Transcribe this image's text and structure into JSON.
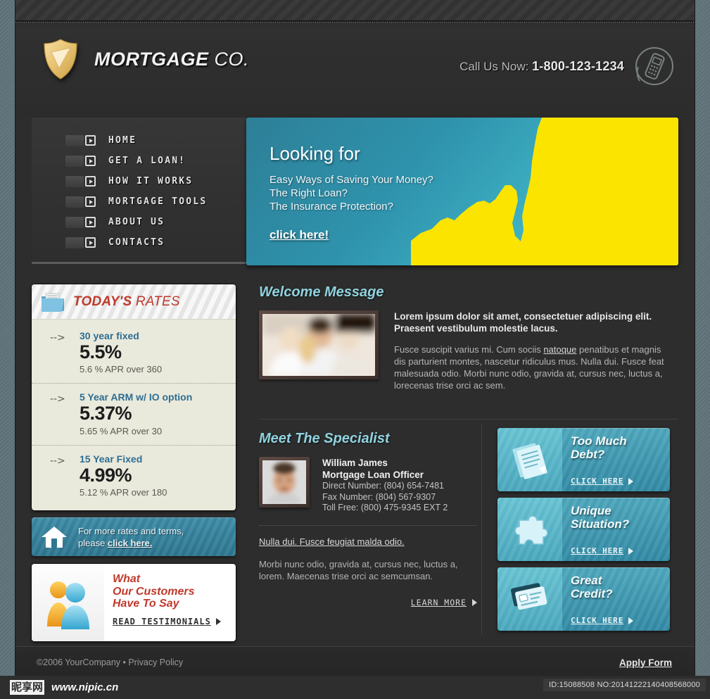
{
  "brand": {
    "name_bold": "MORTGAGE",
    "name_light": "CO.",
    "logo_icon": "shield-icon"
  },
  "header": {
    "call_label": "Call Us Now:",
    "phone": "1-800-123-1234",
    "phone_icon": "mobile-phone-icon"
  },
  "nav": {
    "items": [
      {
        "label": "HOME"
      },
      {
        "label": "GET A LOAN!"
      },
      {
        "label": "HOW IT WORKS"
      },
      {
        "label": "MORTGAGE TOOLS"
      },
      {
        "label": "ABOUT US"
      },
      {
        "label": "CONTACTS"
      }
    ]
  },
  "hero": {
    "heading": "Looking for",
    "line1": "Easy Ways of Saving Your Money?",
    "line2": "The Right Loan?",
    "line3": "The Insurance Protection?",
    "cta": "click here!",
    "colors": {
      "teal_dark": "#2d7f97",
      "teal_light": "#53d0d8",
      "yellow": "#fbe500"
    }
  },
  "rates": {
    "title_bold": "TODAY'S",
    "title_light": "RATES",
    "icon": "folder-icon",
    "accent_color": "#c0392b",
    "items": [
      {
        "arrow": "-->",
        "name": "30 year fixed",
        "percent": "5.5%",
        "apr": "5.6 % APR over 360"
      },
      {
        "arrow": "-->",
        "name": "5 Year ARM w/ IO option",
        "percent": "5.37%",
        "apr": "5.65 % APR over 30"
      },
      {
        "arrow": "-->",
        "name": "15 Year Fixed",
        "percent": "4.99%",
        "apr": "5.12 % APR over 180"
      }
    ]
  },
  "more_rates": {
    "icon": "house-icon",
    "line1": "For more rates and terms,",
    "line2_prefix": "please ",
    "line2_link": "click here."
  },
  "testimonials": {
    "icon": "two-people-icon",
    "line1": "What",
    "line2": "Our Customers",
    "line3": "Have To Say",
    "cta": "READ TESTIMONIALS"
  },
  "welcome": {
    "title": "Welcome Message",
    "image": "family-photo",
    "lead": "Lorem ipsum dolor sit amet, consectetuer adipiscing elit. Praesent vestibulum molestie lacus.",
    "body_before": "Fusce suscipit varius mi. Cum sociis ",
    "body_link": "natoque",
    "body_after": " penatibus et magnis dis parturient montes, nascetur ridiculus mus. Nulla dui. Fusce feat malesuada odio. Morbi nunc odio, gravida at, cursus nec, luctus a, lorecenas trise orci ac sem."
  },
  "specialist": {
    "title": "Meet The Specialist",
    "image": "headshot-photo",
    "name": "William James",
    "role": "Mortgage Loan Officer",
    "direct": "Direct Number: (804) 654-7481",
    "fax": "Fax Number: (804) 567-9307",
    "tollfree": "Toll Free: (800) 475-9345 EXT 2",
    "link": "Nulla dui. Fusce feugiat malda odio.",
    "body": "Morbi nunc odio, gravida at, cursus nec, luctus a, lorem. Maecenas trise orci ac semcumsan.",
    "learn_more": "LEARN MORE"
  },
  "promos": [
    {
      "icon": "documents-icon",
      "line1": "Too Much",
      "line2": "Debt?",
      "cta": "CLICK HERE"
    },
    {
      "icon": "puzzle-piece-icon",
      "line1": "Unique",
      "line2": "Situation?",
      "cta": "CLICK HERE"
    },
    {
      "icon": "credit-card-icon",
      "line1": "Great",
      "line2": "Credit?",
      "cta": "CLICK HERE"
    }
  ],
  "footer": {
    "copyright": "©2006 YourCompany • Privacy Policy",
    "apply": "Apply Form"
  },
  "watermark": {
    "logo_cn": "昵享网",
    "url": "www.nipic.cn",
    "id": "ID:15088508 NO:20141222140408568000"
  }
}
